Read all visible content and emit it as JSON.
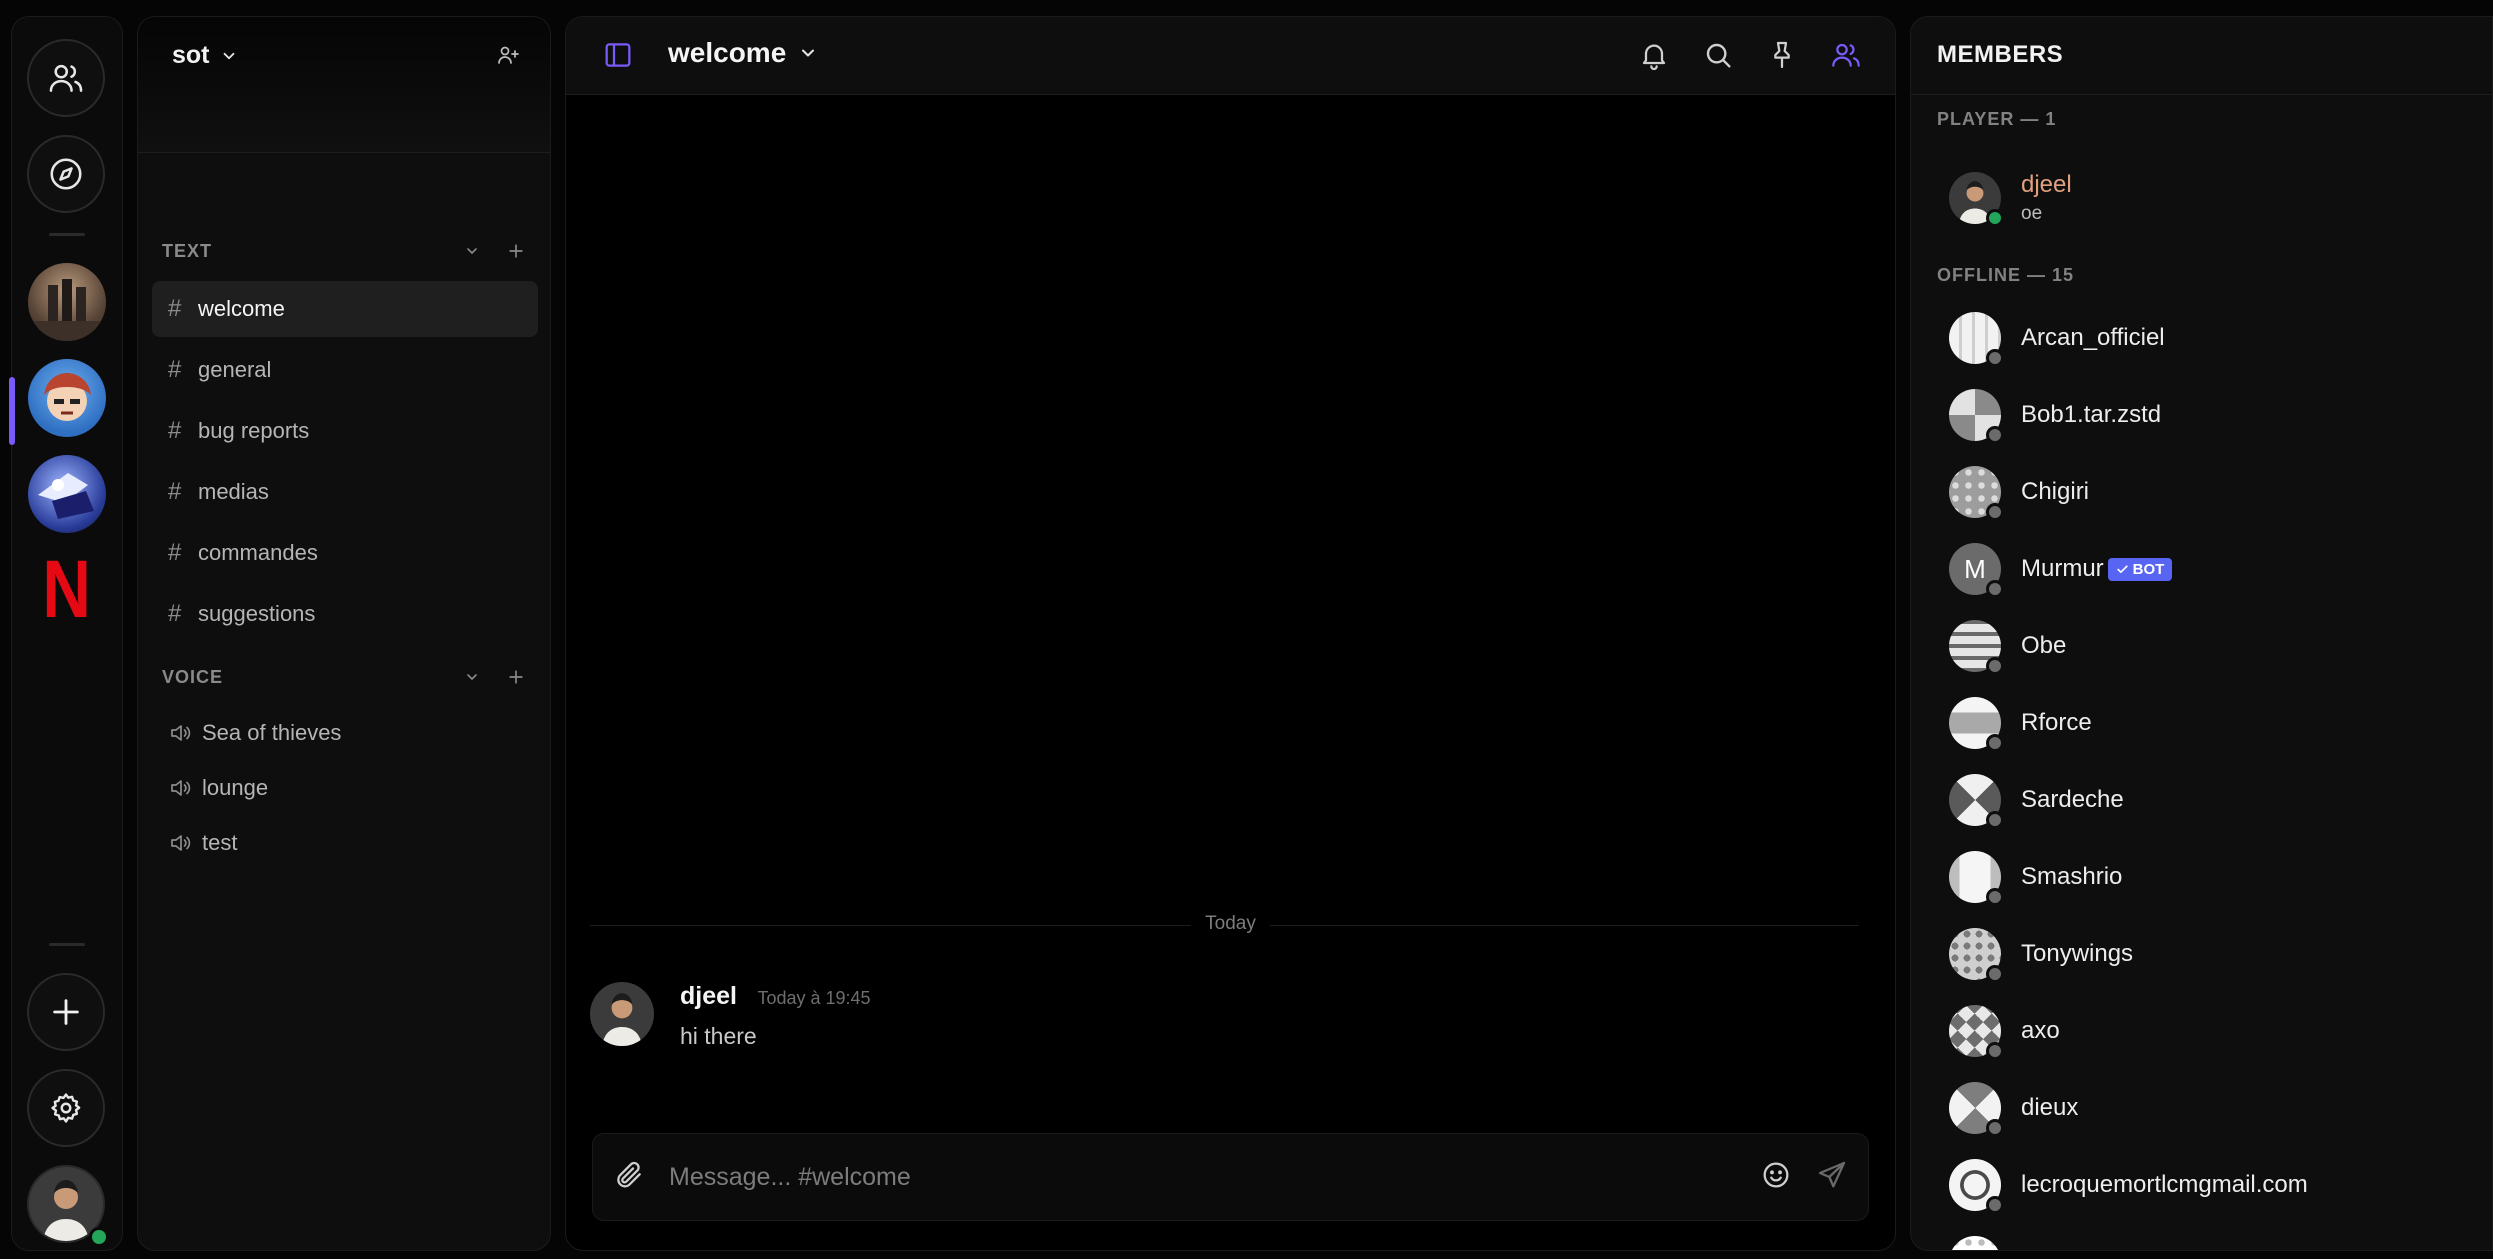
{
  "rail": {
    "friends_icon": "users-icon",
    "explore_icon": "compass-icon",
    "servers": [
      {
        "name": "server-1",
        "color": "#6e5a4b"
      },
      {
        "name": "server-2",
        "color": "#3a78c8"
      },
      {
        "name": "server-3",
        "color": "#2a3d9b"
      },
      {
        "name": "server-netflix",
        "color": "#e50914"
      }
    ],
    "netflix_logo": "N",
    "add_icon": "plus-icon",
    "settings_icon": "gear-icon"
  },
  "sidebar": {
    "guild_name": "sot",
    "text_category": "TEXT",
    "voice_category": "VOICE",
    "text_channels": [
      "welcome",
      "general",
      "bug reports",
      "medias",
      "commandes",
      "suggestions"
    ],
    "voice_channels": [
      "Sea of thieves",
      "lounge",
      "test"
    ]
  },
  "main": {
    "channel_title": "welcome",
    "day_divider": "Today",
    "messages": [
      {
        "author": "djeel",
        "time": "Today à 19:45",
        "text": "hi there"
      }
    ],
    "composer_placeholder": "Message... #welcome"
  },
  "members": {
    "title": "MEMBERS",
    "online_group": "PLAYER — 1",
    "online": [
      {
        "name": "djeel",
        "status_text": "oe",
        "name_color": "#e0a07e"
      }
    ],
    "offline_group": "OFFLINE — 15",
    "offline": [
      {
        "name": "Arcan_officiel"
      },
      {
        "name": "Bob1.tar.zstd"
      },
      {
        "name": "Chigiri"
      },
      {
        "name": "Murmur",
        "badge": "BOT",
        "avatar_letter": "M"
      },
      {
        "name": "Obe"
      },
      {
        "name": "Rforce"
      },
      {
        "name": "Sardeche"
      },
      {
        "name": "Smashrio"
      },
      {
        "name": "Tonywings"
      },
      {
        "name": "axo"
      },
      {
        "name": "dieux"
      },
      {
        "name": "lecroquemortlcmgmail.com"
      }
    ]
  },
  "colors": {
    "accent": "#7a5af8",
    "online": "#23a55a",
    "bot_badge": "#5865f2"
  }
}
